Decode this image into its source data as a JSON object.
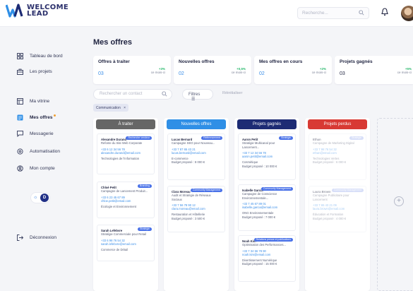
{
  "logo": {
    "line1": "WELCOME",
    "line2": "LEAD"
  },
  "header": {
    "search_placeholder": "Recherche..."
  },
  "sidebar": {
    "items": [
      {
        "label": "Tableau de bord"
      },
      {
        "label": "Les projets"
      },
      {
        "label": "Ma vitrine"
      },
      {
        "label": "Mes offres"
      },
      {
        "label": "Messagerie"
      },
      {
        "label": "Automatisation"
      },
      {
        "label": "Mon compte"
      }
    ],
    "logout": "Déconnexion",
    "theme_knob": "D"
  },
  "main": {
    "title": "Mes offres",
    "stats": [
      {
        "label": "Offres à traiter",
        "value": "03",
        "delta": "+3%",
        "period": "ce mois-ci"
      },
      {
        "label": "Nouvelles offres",
        "value": "02",
        "delta": "+0,5%",
        "period": "ce mois-ci"
      },
      {
        "label": "Mes offres en cours",
        "value": "02",
        "delta": "+2%",
        "period": "ce mois-ci"
      },
      {
        "label": "Projets gagnés",
        "value": "03",
        "delta": "+5%",
        "period": "ce mois-ci"
      }
    ],
    "contact_placeholder": "Rechercher un contact",
    "filters_label": "Filtres",
    "reset_label": "Réinitialiser",
    "active_filter": "Communication",
    "active_filter_close": "×",
    "colors": {
      "a_traiter": "#666666",
      "nouvelles": "#2f8fe6",
      "gagnes": "#1d2b74",
      "perdus": "#d83a34"
    }
  },
  "columns": [
    {
      "title": "À traiter",
      "cards": [
        {
          "tag": "Recherche vendeur",
          "name": "Alexandre Durand",
          "line": "Refonte du Site Web Corporate",
          "phone": "+33 6 12 34 56 78",
          "email": "alexandre.durand@email.com",
          "extra": "Technologies de l'Information"
        },
        {
          "tag": "Branding",
          "name": "Chloé Petit",
          "line": "Campagne de Lancement Produit...",
          "phone": "+33 6 23 45 67 89",
          "email": "chloe.petit@email.com",
          "extra": "Écologie et Environnement"
        },
        {
          "tag": "Stratégie",
          "name": "Sarah Lefebvre",
          "line": "Stratégie Commerciale pour Retail",
          "phone": "+33 6 98 76 54 32",
          "email": "sarah.lefebvre@email.com",
          "extra": "Commerce de Détail"
        }
      ]
    },
    {
      "title": "Nouvelles offres",
      "cards": [
        {
          "tag": "Référencement",
          "name": "Lucas Bernard",
          "line": "Campagne SEO pour Nouveau...",
          "phone": "+33 7 87 65 43 21",
          "email": "lucas.bernard@email.com",
          "extra": "E-commerce",
          "budget": "Budget proposé : 8 000 €"
        },
        {
          "tag": "Community Management",
          "name": "Clara Moreau",
          "line": "Audit et Stratégie de Réseaux Sociaux",
          "phone": "+33 7 56 78 90 12",
          "email": "clara.moreau@email.com",
          "extra": "Restauration et Hôtellerie",
          "budget": "Budget proposé : 3 500 €"
        }
      ]
    },
    {
      "title": "Projets gagnés",
      "cards": [
        {
          "tag": "Stratégie",
          "name": "Aaron Petit",
          "line": "Stratégie Multicanal pour Lancement...",
          "phone": "+33 7 12 34 56 78",
          "email": "aaron.petit@email.com",
          "extra": "Cosmétique",
          "budget": "Budget proposé : 10 000 €"
        },
        {
          "tag": "Community Management",
          "name": "Isabelle Garcia",
          "line": "Campagne de Conscience Environnementale...",
          "phone": "+33 7 45 67 89 01",
          "email": "isabelle.garcia@email.com",
          "extra": "ONG Environnementale",
          "budget": "Budget proposé : 7 000 €"
        },
        {
          "tag": "Relations presse et publications",
          "name": "Noah Kim",
          "line": "Optimisation des Performances...",
          "phone": "+33 7 34 56 78 90",
          "email": "noah.kim@email.com",
          "extra": "Divertissement Numérique",
          "budget": "Budget proposé : 15 000 €"
        }
      ]
    },
    {
      "title": "Projets perdus",
      "cards": [
        {
          "tag": "Stratégie",
          "name": "Ethan",
          "line": "Campagne de Marketing Digital",
          "phone": "+33 7 98 76 54 32",
          "email": "ethan@email.com",
          "extra": "Technologies Vertes",
          "budget": "Budget proposé : 6 000 €"
        },
        {
          "tag": "Community Management",
          "name": "Laura Brown",
          "line": "Campagne Publicitaire pour Lancement",
          "phone": "+33 7 65 43 21 09",
          "email": "laura.brown@email.com",
          "extra": "Éducation et Formation",
          "budget": "Budget proposé : 4 000 €"
        }
      ]
    }
  ],
  "add_column": "+"
}
